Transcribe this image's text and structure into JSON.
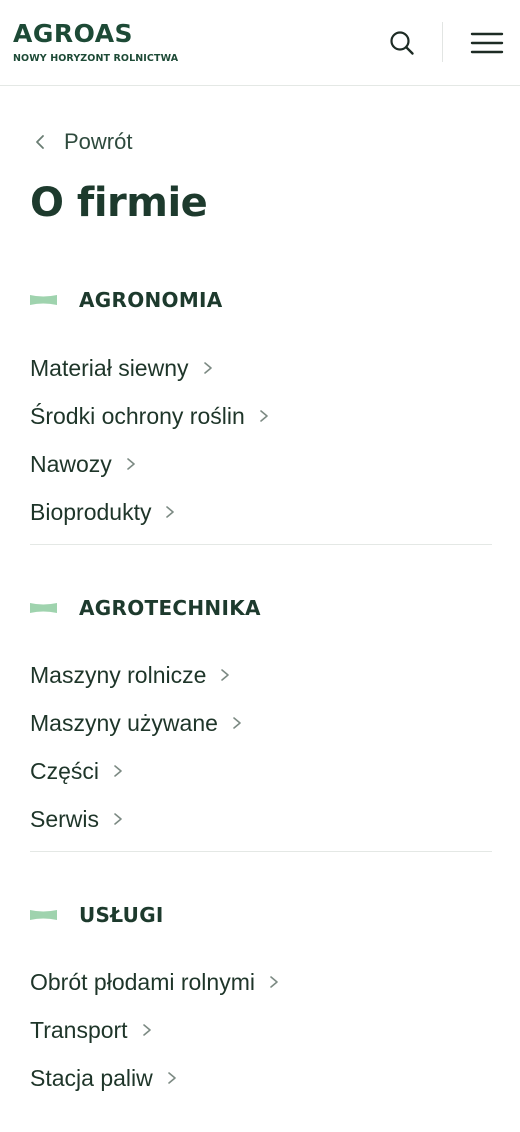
{
  "header": {
    "logo_word": "AGROAS",
    "logo_tagline": "NOWY HORYZONT ROLNICTWA",
    "search_icon": "search-icon",
    "menu_icon": "hamburger-menu-icon"
  },
  "back": {
    "label": "Powrót",
    "icon": "chevron-left-icon"
  },
  "page_title": "O firmie",
  "colors": {
    "brand": "#1d4a36",
    "accent_leaf": "#9fd3ae",
    "text": "#1e3529"
  },
  "sections": [
    {
      "title": "AGRONOMIA",
      "items": [
        {
          "label": "Materiał siewny"
        },
        {
          "label": "Środki ochrony roślin"
        },
        {
          "label": "Nawozy"
        },
        {
          "label": "Bioprodukty"
        }
      ]
    },
    {
      "title": "AGROTECHNIKA",
      "items": [
        {
          "label": "Maszyny rolnicze"
        },
        {
          "label": "Maszyny używane"
        },
        {
          "label": "Części"
        },
        {
          "label": "Serwis"
        }
      ]
    },
    {
      "title": "USŁUGI",
      "items": [
        {
          "label": "Obrót płodami rolnymi"
        },
        {
          "label": "Transport"
        },
        {
          "label": "Stacja paliw"
        }
      ]
    }
  ]
}
